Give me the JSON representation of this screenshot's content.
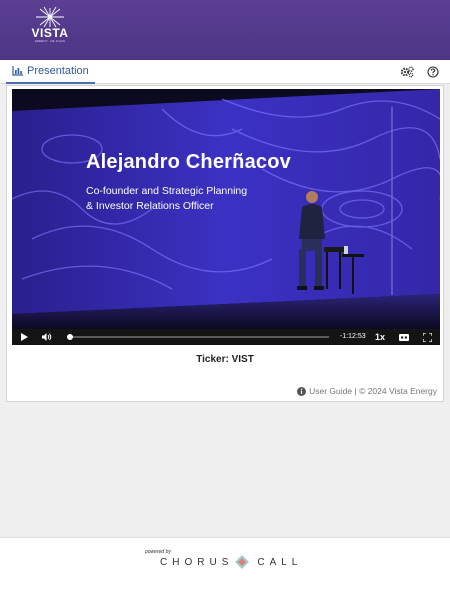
{
  "header": {
    "logo_text": "VISTA",
    "logo_subtext": "ENERGY · OIL & GAS",
    "brand_color": "#55398c"
  },
  "tabs": [
    {
      "label": "Presentation",
      "icon": "chart-icon",
      "active": true
    }
  ],
  "toolbar": {
    "settings_icon": "gears-icon",
    "help_icon": "help-icon"
  },
  "video": {
    "overlay_name": "Alejandro Cherñacov",
    "overlay_title_line1": "Co-founder and Strategic Planning",
    "overlay_title_line2": "& Investor Relations Officer",
    "time_remaining": "-1:12:53",
    "playback_speed": "1x",
    "progress_fraction": 0.01
  },
  "ticker": "Ticker: VIST",
  "footer_note": {
    "link_label": "User Guide",
    "separator": " | ",
    "copyright": "© 2024 Vista Energy"
  },
  "powered": {
    "label": "powered by",
    "brand_left": "CHORUS",
    "brand_right": "CALL"
  }
}
